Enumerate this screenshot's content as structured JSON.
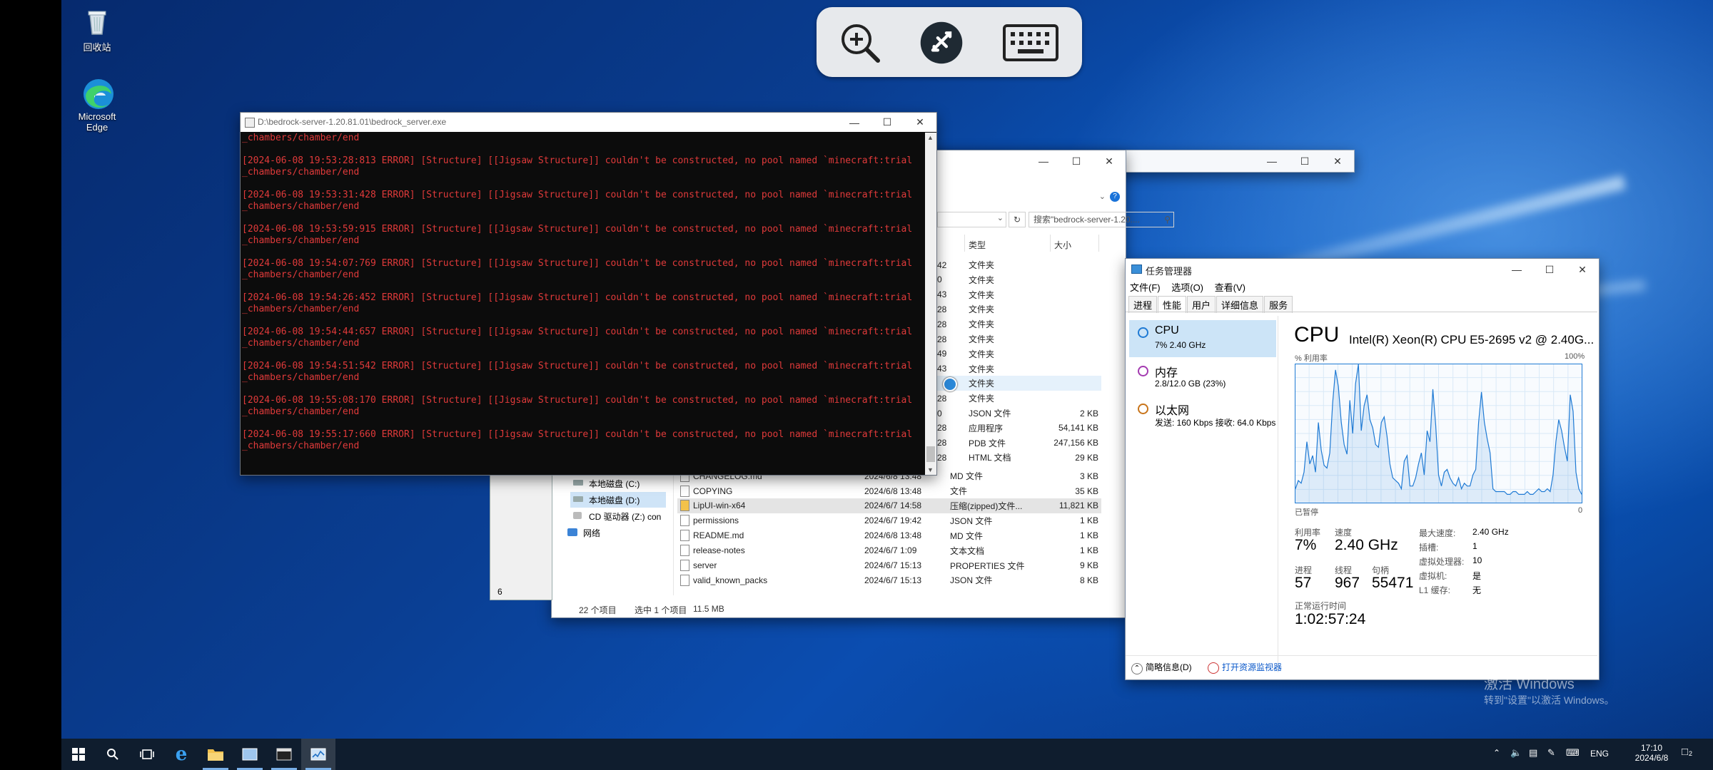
{
  "desktop": {
    "recycle_bin_label": "回收站",
    "edge_label_line1": "Microsoft",
    "edge_label_line2": "Edge"
  },
  "console": {
    "title": "D:\\bedrock-server-1.20.81.01\\bedrock_server.exe",
    "lines": [
      "_chambers/chamber/end",
      "",
      "[2024-06-08 19:53:28:813 ERROR] [Structure] [[Jigsaw Structure]] couldn't be constructed, no pool named `minecraft:trial",
      "_chambers/chamber/end",
      "",
      "[2024-06-08 19:53:31:428 ERROR] [Structure] [[Jigsaw Structure]] couldn't be constructed, no pool named `minecraft:trial",
      "_chambers/chamber/end",
      "",
      "[2024-06-08 19:53:59:915 ERROR] [Structure] [[Jigsaw Structure]] couldn't be constructed, no pool named `minecraft:trial",
      "_chambers/chamber/end",
      "",
      "[2024-06-08 19:54:07:769 ERROR] [Structure] [[Jigsaw Structure]] couldn't be constructed, no pool named `minecraft:trial",
      "_chambers/chamber/end",
      "",
      "[2024-06-08 19:54:26:452 ERROR] [Structure] [[Jigsaw Structure]] couldn't be constructed, no pool named `minecraft:trial",
      "_chambers/chamber/end",
      "",
      "[2024-06-08 19:54:44:657 ERROR] [Structure] [[Jigsaw Structure]] couldn't be constructed, no pool named `minecraft:trial",
      "_chambers/chamber/end",
      "",
      "[2024-06-08 19:54:51:542 ERROR] [Structure] [[Jigsaw Structure]] couldn't be constructed, no pool named `minecraft:trial",
      "_chambers/chamber/end",
      "",
      "[2024-06-08 19:55:08:170 ERROR] [Structure] [[Jigsaw Structure]] couldn't be constructed, no pool named `minecraft:trial",
      "_chambers/chamber/end",
      "",
      "[2024-06-08 19:55:17:660 ERROR] [Structure] [[Jigsaw Structure]] couldn't be constructed, no pool named `minecraft:trial",
      "_chambers/chamber/end"
    ]
  },
  "explorer": {
    "search_placeholder": "搜索\"bedrock-server-1.20....",
    "col_type": "类型",
    "col_size": "大小",
    "folder_rows": [
      {
        "date_tail": "42",
        "type": "文件夹"
      },
      {
        "date_tail": "0",
        "type": "文件夹"
      },
      {
        "date_tail": "43",
        "type": "文件夹"
      },
      {
        "date_tail": "28",
        "type": "文件夹"
      },
      {
        "date_tail": "28",
        "type": "文件夹"
      },
      {
        "date_tail": "28",
        "type": "文件夹"
      },
      {
        "date_tail": "49",
        "type": "文件夹"
      },
      {
        "date_tail": "43",
        "type": "文件夹"
      },
      {
        "date_tail": "",
        "type": "文件夹"
      },
      {
        "date_tail": "28",
        "type": "文件夹"
      },
      {
        "date_tail": "0",
        "type": "JSON 文件",
        "size": "2 KB"
      },
      {
        "date_tail": "28",
        "type": "应用程序",
        "size": "54,141 KB"
      },
      {
        "date_tail": "28",
        "type": "PDB 文件",
        "size": "247,156 KB"
      },
      {
        "date_tail": "28",
        "type": "HTML 文档",
        "size": "29 KB"
      }
    ],
    "partial_row": {
      "name": "CHANGELOG.md",
      "date": "2024/6/8 13:48",
      "type": "MD 文件",
      "size": "3 KB"
    },
    "files": [
      {
        "name": "COPYING",
        "date": "2024/6/8 13:48",
        "type": "文件",
        "size": "35 KB"
      },
      {
        "name": "LipUI-win-x64",
        "date": "2024/6/7 14:58",
        "type": "压缩(zipped)文件...",
        "size": "11,821 KB"
      },
      {
        "name": "permissions",
        "date": "2024/6/7 19:42",
        "type": "JSON 文件",
        "size": "1 KB"
      },
      {
        "name": "README.md",
        "date": "2024/6/8 13:48",
        "type": "MD 文件",
        "size": "1 KB"
      },
      {
        "name": "release-notes",
        "date": "2024/6/7 1:09",
        "type": "文本文档",
        "size": "1 KB"
      },
      {
        "name": "server",
        "date": "2024/6/7 15:13",
        "type": "PROPERTIES 文件",
        "size": "9 KB"
      },
      {
        "name": "valid_known_packs",
        "date": "2024/6/7 15:13",
        "type": "JSON 文件",
        "size": "8 KB"
      }
    ],
    "nav": {
      "drive_c": "本地磁盘 (C:)",
      "drive_d": "本地磁盘 (D:)",
      "drive_z": "CD 驱动器 (Z:) con",
      "network": "网络"
    },
    "status_items": "22 个项目",
    "status_selected": "选中 1 个项目",
    "status_size": "11.5 MB",
    "left_digit": "6"
  },
  "taskmgr": {
    "title": "任务管理器",
    "menu": [
      "文件(F)",
      "选项(O)",
      "查看(V)"
    ],
    "tabs": [
      "进程",
      "性能",
      "用户",
      "详细信息",
      "服务"
    ],
    "side": {
      "cpu_name": "CPU",
      "cpu_detail": "7% 2.40 GHz",
      "mem_name": "内存",
      "mem_detail": "2.8/12.0 GB (23%)",
      "net_name": "以太网",
      "net_detail": "发送: 160 Kbps 接收: 64.0 Kbps"
    },
    "header_title": "CPU",
    "cpu_model": "Intel(R) Xeon(R) CPU E5-2695 v2 @ 2.40G...",
    "graph_left_label": "% 利用率",
    "graph_right_label": "100%",
    "graph_bottom_left": "已暂停",
    "graph_bottom_right": "0",
    "stats": {
      "util_label": "利用率",
      "util_value": "7%",
      "speed_label": "速度",
      "speed_value": "2.40 GHz",
      "proc_label": "进程",
      "proc_value": "57",
      "thread_label": "线程",
      "thread_value": "967",
      "handle_label": "句柄",
      "handle_value": "55471",
      "uptime_label": "正常运行时间",
      "uptime_value": "1:02:57:24"
    },
    "right_stats": [
      {
        "k": "最大速度:",
        "v": "2.40 GHz"
      },
      {
        "k": "插槽:",
        "v": "1"
      },
      {
        "k": "虚拟处理器:",
        "v": "10"
      },
      {
        "k": "虚拟机:",
        "v": "是"
      },
      {
        "k": "L1 缓存:",
        "v": "无"
      }
    ],
    "footer_less": "简略信息(D)",
    "footer_monitor": "打开资源监视器"
  },
  "chart_data": {
    "type": "area",
    "title": "",
    "xlabel": "",
    "ylabel": "% 利用率",
    "ylim": [
      0,
      100
    ],
    "grid": true,
    "series": [
      {
        "values": [
          10,
          16,
          14,
          22,
          44,
          28,
          34,
          22,
          58,
          38,
          27,
          25,
          36,
          72,
          96,
          84,
          58,
          42,
          35,
          74,
          50,
          86,
          100,
          52,
          70,
          78,
          60,
          54,
          42,
          40,
          58,
          62,
          48,
          28,
          18,
          16,
          14,
          10,
          30,
          34,
          12,
          12,
          18,
          28,
          36,
          20,
          52,
          44,
          82,
          56,
          20,
          12,
          22,
          24,
          18,
          14,
          12,
          18,
          10,
          14,
          12,
          12,
          20,
          24,
          58,
          80,
          58,
          46,
          36,
          10,
          8,
          8,
          8,
          8,
          6,
          6,
          8,
          8,
          6,
          6,
          6,
          8,
          6,
          6,
          8,
          10,
          8,
          8,
          10,
          8,
          20,
          44,
          60,
          52,
          40,
          30,
          78,
          66,
          22,
          10,
          6
        ]
      }
    ]
  },
  "watermark": {
    "line1": "激活 Windows",
    "line2": "转到\"设置\"以激活 Windows。"
  },
  "taskbar": {
    "ime": "ENG",
    "time": "17:10",
    "date": "2024/6/8",
    "notif_count": "2"
  }
}
